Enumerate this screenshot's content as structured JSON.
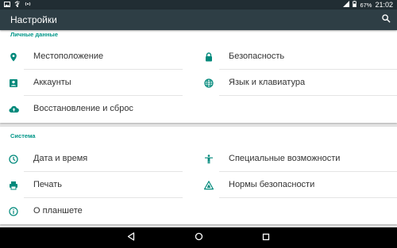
{
  "status_bar": {
    "time": "21:02",
    "battery_percent": "67%",
    "icons": [
      "image-icon",
      "usb-icon",
      "hotspot-icon",
      "signal-icon",
      "battery-icon"
    ]
  },
  "toolbar": {
    "title": "Настройки",
    "search_icon": "search-icon"
  },
  "sections": {
    "personal": {
      "header": "Личные данные",
      "items": [
        {
          "label": "Местоположение",
          "icon": "location-icon"
        },
        {
          "label": "Безопасность",
          "icon": "lock-icon"
        },
        {
          "label": "Аккаунты",
          "icon": "account-icon"
        },
        {
          "label": "Язык и клавиатура",
          "icon": "globe-icon"
        },
        {
          "label": "Восстановление и сброс",
          "icon": "cloud-upload-icon"
        }
      ]
    },
    "system": {
      "header": "Система",
      "items": [
        {
          "label": "Дата и время",
          "icon": "clock-icon"
        },
        {
          "label": "Специальные возможности",
          "icon": "accessibility-icon"
        },
        {
          "label": "Печать",
          "icon": "print-icon"
        },
        {
          "label": "Нормы безопасности",
          "icon": "warning-icon"
        },
        {
          "label": "О планшете",
          "icon": "info-icon"
        }
      ]
    }
  },
  "nav_bar": {
    "buttons": [
      "back-icon",
      "home-icon",
      "recents-icon"
    ]
  },
  "colors": {
    "accent": "#009688",
    "toolbar": "#2e3e45",
    "status_bar": "#212d33",
    "icon": "#00897b"
  }
}
